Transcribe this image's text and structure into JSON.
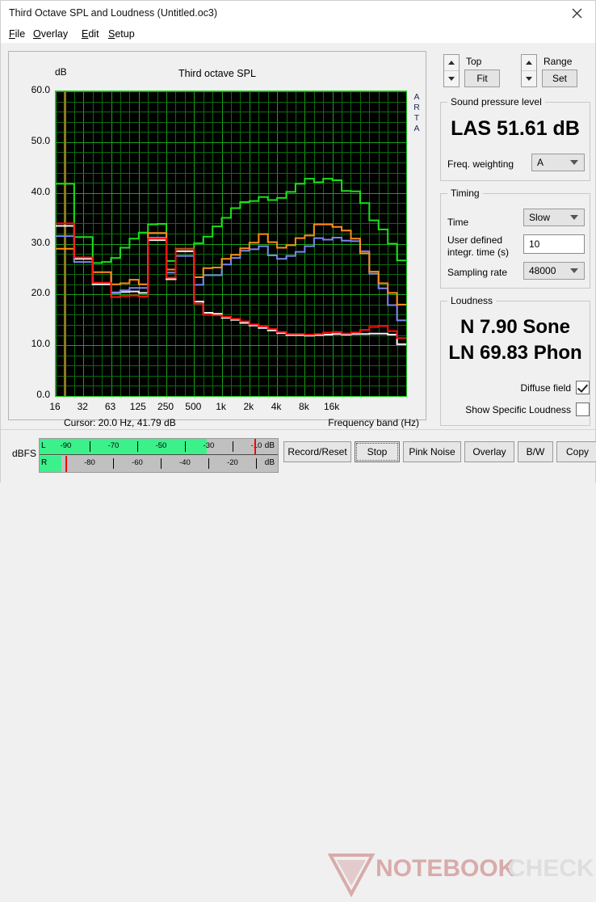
{
  "window": {
    "title": "Third Octave SPL and Loudness (Untitled.oc3)",
    "close_icon": "close-icon"
  },
  "menu": [
    {
      "label": "File",
      "accel": "F"
    },
    {
      "label": "Overlay",
      "accel": "O"
    },
    {
      "label": "Edit",
      "accel": "E"
    },
    {
      "label": "Setup",
      "accel": "S"
    }
  ],
  "graph": {
    "title": "Third octave SPL",
    "unit_label": "dB",
    "watermark_label": "ARTA",
    "cursor_text": "Cursor:   20.0 Hz, 41.79 dB",
    "xaxis_title": "Frequency band (Hz)"
  },
  "chart_data": {
    "type": "line",
    "title": "Third octave SPL",
    "xlabel": "Frequency band (Hz)",
    "ylabel": "dB",
    "ylim": [
      0.0,
      60.0
    ],
    "ytick_labels": [
      "60.0",
      "50.0",
      "40.0",
      "30.0",
      "20.0",
      "10.0",
      "0.0"
    ],
    "ytick_values": [
      60,
      50,
      40,
      30,
      20,
      10,
      0
    ],
    "xtick_labels": [
      "16",
      "32",
      "63",
      "125",
      "250",
      "500",
      "1k",
      "2k",
      "4k",
      "8k",
      "16k"
    ],
    "xtick_values": [
      16,
      32,
      63,
      125,
      250,
      500,
      1000,
      2000,
      4000,
      8000,
      16000
    ],
    "grid": true,
    "legend_position": "none",
    "x_bands": [
      16,
      20,
      25,
      31.5,
      40,
      50,
      63,
      80,
      100,
      125,
      160,
      200,
      250,
      315,
      400,
      500,
      630,
      800,
      1000,
      1250,
      1600,
      2000,
      2500,
      3150,
      4000,
      5000,
      6300,
      8000,
      10000,
      12500,
      16000,
      20000
    ],
    "cursor": {
      "frequency_hz": 20.0,
      "level_db": 41.79,
      "line_color": "#8a7a1e"
    },
    "series": [
      {
        "name": "green",
        "color": "#19e019",
        "values": [
          41.8,
          41.8,
          31.3,
          31.3,
          26.2,
          26.4,
          27.2,
          29.2,
          31.0,
          32.2,
          33.8,
          33.9,
          26.6,
          29.0,
          29.0,
          30.1,
          31.4,
          33.4,
          35.1,
          37.0,
          38.2,
          38.4,
          39.2,
          38.6,
          39.0,
          40.2,
          41.8,
          42.8,
          42.1,
          42.8,
          42.5,
          40.4,
          40.3,
          38.0,
          34.6,
          32.8,
          30.0,
          26.7,
          26.7
        ]
      },
      {
        "name": "orange",
        "color": "#ff8c1a",
        "values": [
          29.0,
          29.0,
          27.3,
          27.3,
          24.4,
          24.4,
          22.0,
          22.2,
          22.9,
          22.0,
          32.1,
          32.1,
          24.9,
          28.9,
          28.9,
          23.4,
          25.2,
          25.3,
          27.0,
          27.8,
          29.1,
          30.2,
          31.9,
          30.3,
          29.2,
          29.7,
          31.1,
          31.6,
          33.8,
          33.8,
          33.3,
          32.6,
          31.0,
          28.1,
          24.5,
          22.2,
          20.3,
          18.0,
          17.9
        ]
      },
      {
        "name": "blue",
        "color": "#7b85f0",
        "values": [
          31.5,
          31.5,
          26.4,
          26.4,
          22.3,
          22.3,
          20.4,
          20.8,
          21.3,
          21.3,
          31.2,
          31.2,
          24.3,
          27.6,
          27.6,
          21.9,
          23.8,
          23.8,
          25.9,
          27.2,
          28.6,
          28.9,
          29.5,
          27.7,
          27.0,
          27.6,
          28.4,
          29.5,
          31.1,
          30.8,
          31.2,
          30.6,
          30.5,
          28.5,
          24.1,
          21.2,
          17.9,
          14.9,
          14.9
        ]
      },
      {
        "name": "red",
        "color": "#ff0f0f",
        "values": [
          34.0,
          34.0,
          27.3,
          27.3,
          22.3,
          22.3,
          19.5,
          19.7,
          19.8,
          19.6,
          31.0,
          31.0,
          23.3,
          28.9,
          28.9,
          18.2,
          16.0,
          15.9,
          15.6,
          15.2,
          14.7,
          14.1,
          13.7,
          13.2,
          12.6,
          12.2,
          12.2,
          12.1,
          12.2,
          12.5,
          12.6,
          12.3,
          12.5,
          13.0,
          13.6,
          13.8,
          12.8,
          11.4,
          11.4
        ]
      },
      {
        "name": "white",
        "color": "#f0f0f0",
        "values": [
          33.5,
          33.5,
          27.0,
          27.0,
          22.0,
          22.0,
          20.3,
          20.5,
          20.6,
          20.3,
          30.7,
          30.7,
          23.0,
          28.5,
          28.5,
          18.6,
          16.4,
          16.2,
          15.4,
          15.0,
          14.4,
          13.9,
          13.4,
          12.9,
          12.4,
          12.0,
          12.0,
          11.9,
          12.0,
          12.1,
          12.2,
          12.1,
          12.2,
          12.2,
          12.3,
          12.3,
          12.1,
          10.2,
          10.2
        ]
      }
    ]
  },
  "controls": {
    "top": {
      "label": "Top",
      "button": "Fit"
    },
    "range": {
      "label": "Range",
      "button": "Set"
    },
    "spl": {
      "group_title": "Sound pressure level",
      "reading": "LAS 51.61 dB",
      "weighting_label": "Freq. weighting",
      "weighting_value": "A"
    },
    "timing": {
      "group_title": "Timing",
      "time_label": "Time",
      "time_value": "Slow",
      "integr_label_line1": "User defined",
      "integr_label_line2": "integr. time (s)",
      "integr_value": "10",
      "sampling_label": "Sampling rate",
      "sampling_value": "48000"
    },
    "loudness": {
      "group_title": "Loudness",
      "sone": "N 7.90 Sone",
      "phon": "LN 69.83 Phon",
      "diffuse_label": "Diffuse field",
      "diffuse_checked": true,
      "specific_label": "Show Specific Loudness",
      "specific_checked": false
    }
  },
  "meter": {
    "label": "dBFS",
    "unit": "dB",
    "left_channel": "L",
    "right_channel": "R",
    "left_ticks": [
      "-90",
      "-70",
      "-50",
      "-30",
      "-10"
    ],
    "right_ticks": [
      "-80",
      "-60",
      "-40",
      "-20"
    ],
    "left_level_pct": 70,
    "right_level_pct": 9,
    "left_peak_pct": 90,
    "right_peak_pct": 11,
    "fill_color": "#3cf08a",
    "peak_color": "#ff0000"
  },
  "buttons": [
    {
      "label": "Record/Reset"
    },
    {
      "label": "Stop"
    },
    {
      "label": "Pink Noise"
    },
    {
      "label": "Overlay"
    },
    {
      "label": "B/W"
    },
    {
      "label": "Copy"
    }
  ],
  "watermark": {
    "text_dark": "NOTEBOOK",
    "text_light": "CHECK",
    "color": "#d4a0a0"
  }
}
